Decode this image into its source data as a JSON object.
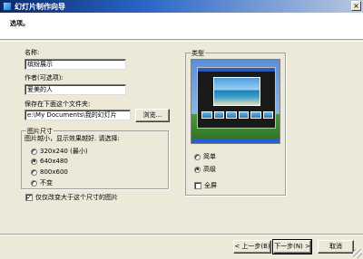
{
  "window": {
    "title": "幻灯片制作向导",
    "close_glyph": "×"
  },
  "header": {
    "heading": "选项。"
  },
  "fields": {
    "name_label": "名称:",
    "name_value": "缤纷展示",
    "author_label": "作者(可选项):",
    "author_value": "爱美的人",
    "save_label": "保存在下面这个文件夹:",
    "save_value": "e:\\My Documents\\我的幻灯片",
    "browse_label": "浏览..."
  },
  "image_size": {
    "title": "图片尺寸",
    "hint": "图片越小，显示效果越好. 请选择:",
    "options": [
      {
        "label": "320x240 (最小)",
        "selected": false
      },
      {
        "label": "640x480",
        "selected": true
      },
      {
        "label": "800x600",
        "selected": false
      },
      {
        "label": "不变",
        "selected": false
      }
    ]
  },
  "shrink_checkbox": {
    "label": "仅仅改变大于这个尺寸的图片",
    "checked": true,
    "check_glyph": "✓"
  },
  "type_group": {
    "title": "类型",
    "options": [
      {
        "label": "简单",
        "selected": false
      },
      {
        "label": "高级",
        "selected": true
      }
    ],
    "fullscreen": {
      "label": "全屏",
      "checked": false
    }
  },
  "buttons": {
    "back": "< 上一步(B)",
    "next": "下一步(N) >",
    "cancel": "取消"
  },
  "colors": {
    "title_bar": "#2a66c8",
    "dialog": "#ece9d8",
    "header": "#ffffff"
  }
}
